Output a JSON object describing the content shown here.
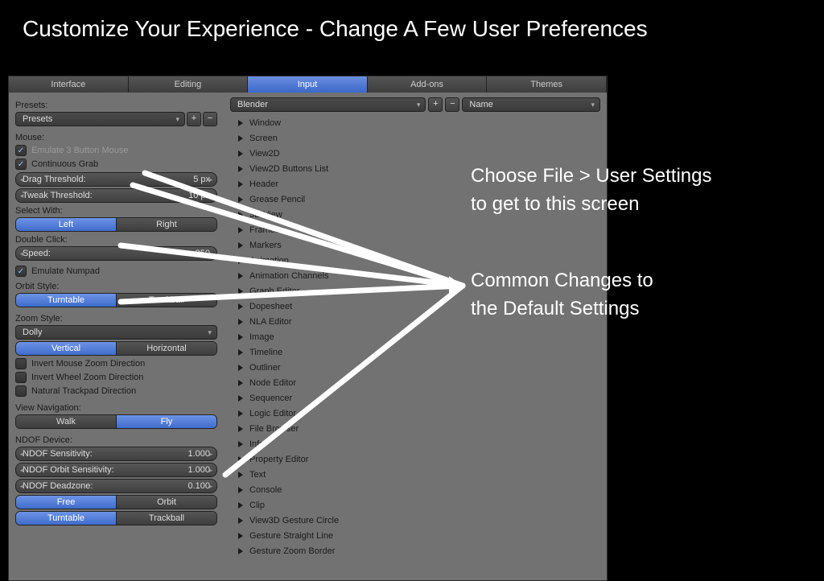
{
  "banner": {
    "title": "Customize Your Experience - Change A Few User Preferences"
  },
  "tabs": [
    "Interface",
    "Editing",
    "Input",
    "Add-ons",
    "Themes"
  ],
  "active_tab": "Input",
  "left": {
    "presets_label": "Presets:",
    "presets_value": "Presets",
    "mouse_label": "Mouse:",
    "emulate3": "Emulate 3 Button Mouse",
    "cont_grab": "Continuous Grab",
    "drag_threshold_label": "Drag Threshold:",
    "drag_threshold_val": "5 px",
    "tweak_threshold_label": "Tweak Threshold:",
    "tweak_threshold_val": "10 px",
    "select_with_label": "Select With:",
    "left": "Left",
    "right": "Right",
    "double_click_label": "Double Click:",
    "speed_label": "Speed:",
    "speed_val": "350",
    "emulate_numpad": "Emulate Numpad",
    "orbit_style_label": "Orbit Style:",
    "turntable": "Turntable",
    "trackball": "Trackball",
    "zoom_style_label": "Zoom Style:",
    "zoom_value": "Dolly",
    "vertical": "Vertical",
    "horizontal": "Horizontal",
    "invert_mouse": "Invert Mouse Zoom Direction",
    "invert_wheel": "Invert Wheel Zoom Direction",
    "natural_trackpad": "Natural Trackpad Direction",
    "view_nav_label": "View Navigation:",
    "walk": "Walk",
    "fly": "Fly",
    "ndof_label": "NDOF Device:",
    "ndof_sens_label": "NDOF Sensitivity:",
    "ndof_sens_val": "1.000",
    "ndof_orbit_label": "NDOF Orbit Sensitivity:",
    "ndof_orbit_val": "1.000",
    "ndof_dead_label": "NDOF Deadzone:",
    "ndof_dead_val": "0.100",
    "free": "Free",
    "orbit": "Orbit",
    "turntable2": "Turntable",
    "trackball2": "Trackball"
  },
  "right": {
    "preset_value": "Blender",
    "sort_value": "Name",
    "plus": "+",
    "minus": "−",
    "items": [
      "Window",
      "Screen",
      "View2D",
      "View2D Buttons List",
      "Header",
      "Grease Pencil",
      "3D View",
      "Frames",
      "Markers",
      "Animation",
      "Animation Channels",
      "Graph Editor",
      "Dopesheet",
      "NLA Editor",
      "Image",
      "Timeline",
      "Outliner",
      "Node Editor",
      "Sequencer",
      "Logic Editor",
      "File Browser",
      "Info",
      "Property Editor",
      "Text",
      "Console",
      "Clip",
      "View3D Gesture Circle",
      "Gesture Straight Line",
      "Gesture Zoom Border"
    ]
  },
  "annot": {
    "line1": "Choose File > User Settings",
    "line2": "to get to this screen",
    "line3": "Common Changes to",
    "line4": "the Default Settings"
  }
}
